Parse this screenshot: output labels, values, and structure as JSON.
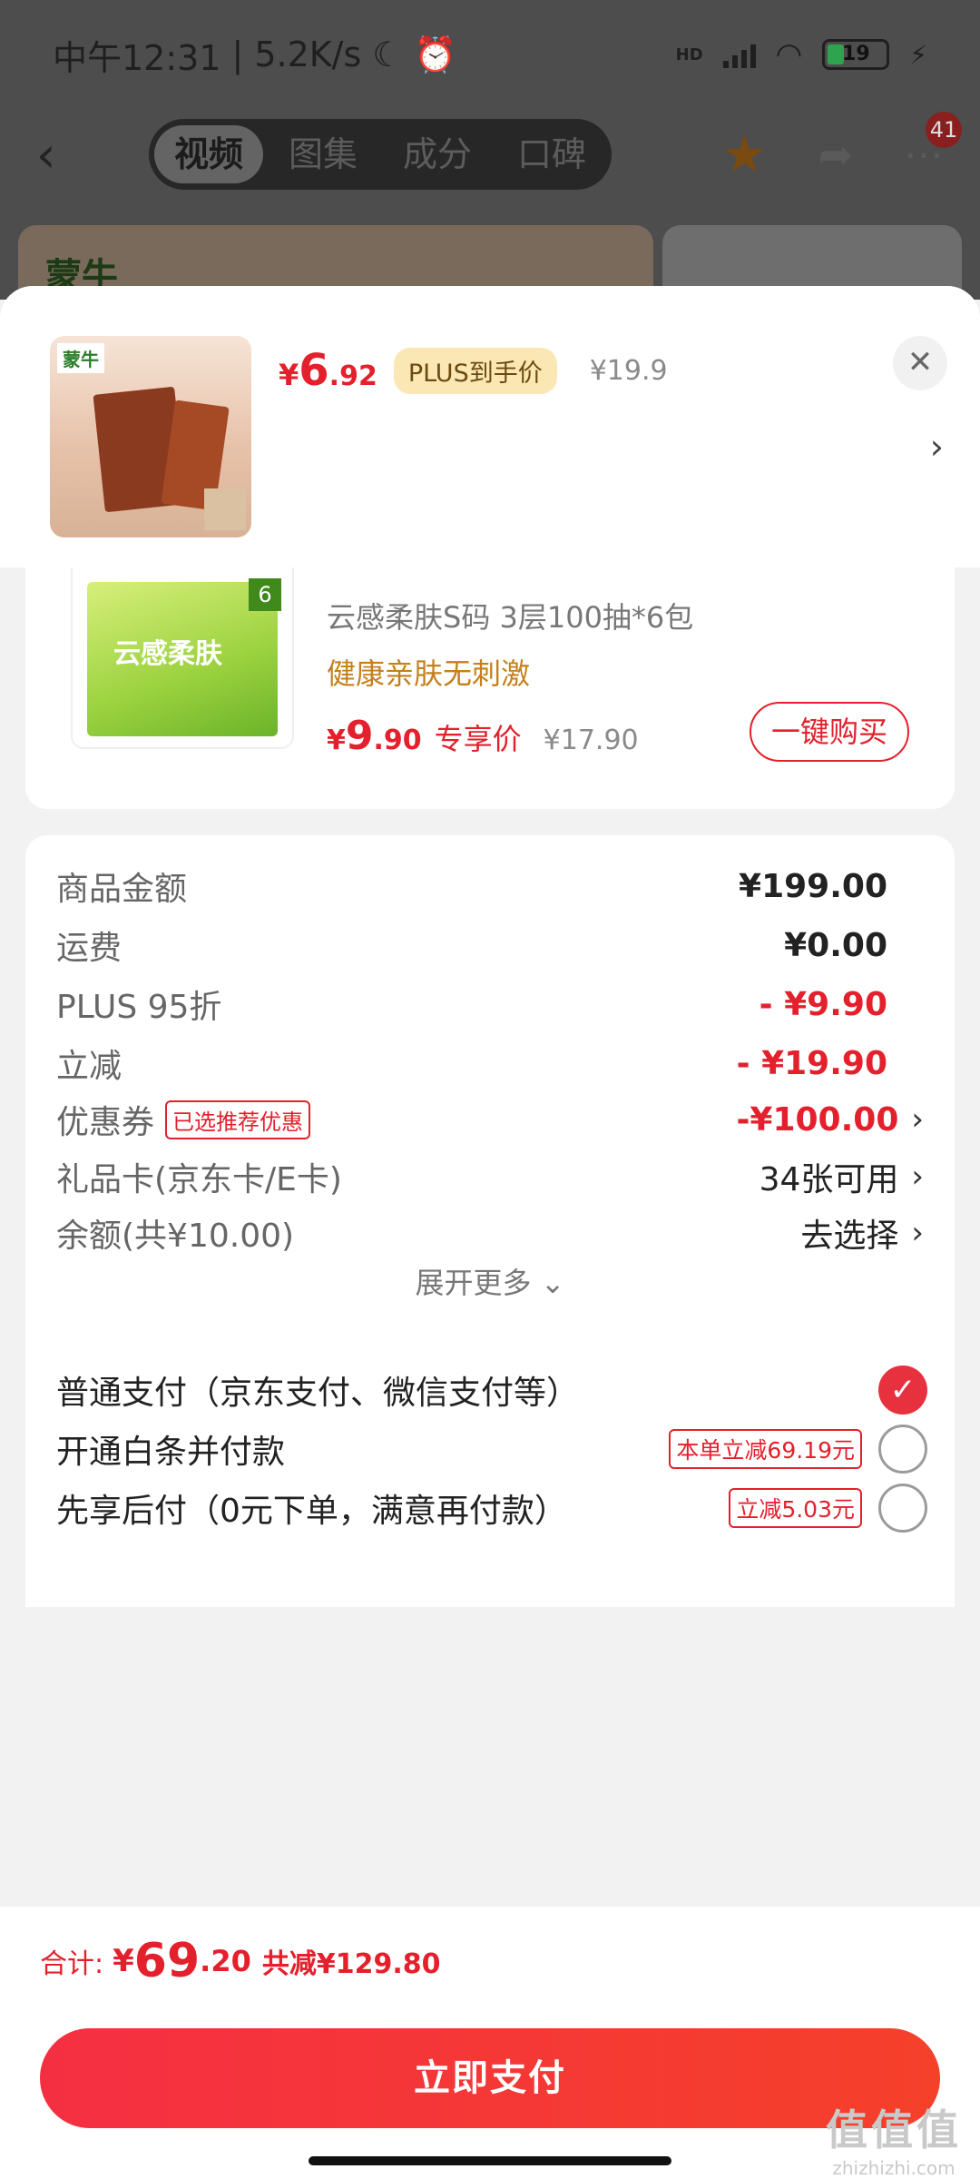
{
  "status_bar": {
    "time": "中午12:31",
    "speed": "5.2K/s",
    "network": "HD",
    "battery": "19"
  },
  "top_nav": {
    "tabs": [
      "视频",
      "图集",
      "成分",
      "口碑"
    ],
    "active_tab": "视频",
    "message_count": "41"
  },
  "background": {
    "brand": "蒙牛"
  },
  "product": {
    "brand_logo": "蒙牛",
    "price_currency": "¥",
    "price_int": "6",
    "price_dec": ".92",
    "plus_tag": "PLUS到手价",
    "original_price": "¥19.9"
  },
  "recommendation": {
    "pack_label": "云感柔肤",
    "pack_count": "6",
    "title": "云感柔肤S码 3层100抽*6包",
    "subtitle": "健康亲肤无刺激",
    "price_currency": "¥",
    "price_int": "9",
    "price_dec": ".90",
    "price_label": "专享价",
    "original_price": "¥17.90",
    "buy_button": "一键购买"
  },
  "summary": {
    "rows": [
      {
        "label": "商品金额",
        "value": "¥199.00"
      },
      {
        "label": "运费",
        "value": "¥0.00"
      },
      {
        "label": "PLUS 95折",
        "value": "- ¥9.90"
      },
      {
        "label": "立减",
        "value": "- ¥19.90"
      },
      {
        "label": "优惠券",
        "tag": "已选推荐优惠",
        "value": "-¥100.00"
      },
      {
        "label": "礼品卡(京东卡/E卡)",
        "value": "34张可用"
      },
      {
        "label": "余额(共¥10.00)",
        "value": "去选择"
      }
    ],
    "expand_more": "展开更多"
  },
  "payment": {
    "options": [
      {
        "label": "普通支付（京东支付、微信支付等）",
        "tag": "",
        "selected": true
      },
      {
        "label": "开通白条并付款",
        "tag": "本单立减69.19元",
        "selected": false
      },
      {
        "label": "先享后付（0元下单，满意再付款）",
        "tag": "立减5.03元",
        "selected": false
      }
    ]
  },
  "total": {
    "label": "合计:",
    "currency": "¥",
    "amount_int": "69",
    "amount_dec": ".20",
    "saved": "共减¥129.80"
  },
  "pay_button": "立即支付",
  "watermark": {
    "main": "值值值",
    "url": "zhizhizhi.com"
  },
  "colors": {
    "accent_red": "#e4202c",
    "plus_gold": "#fbe7b3",
    "subtitle_orange": "#c5801c"
  }
}
